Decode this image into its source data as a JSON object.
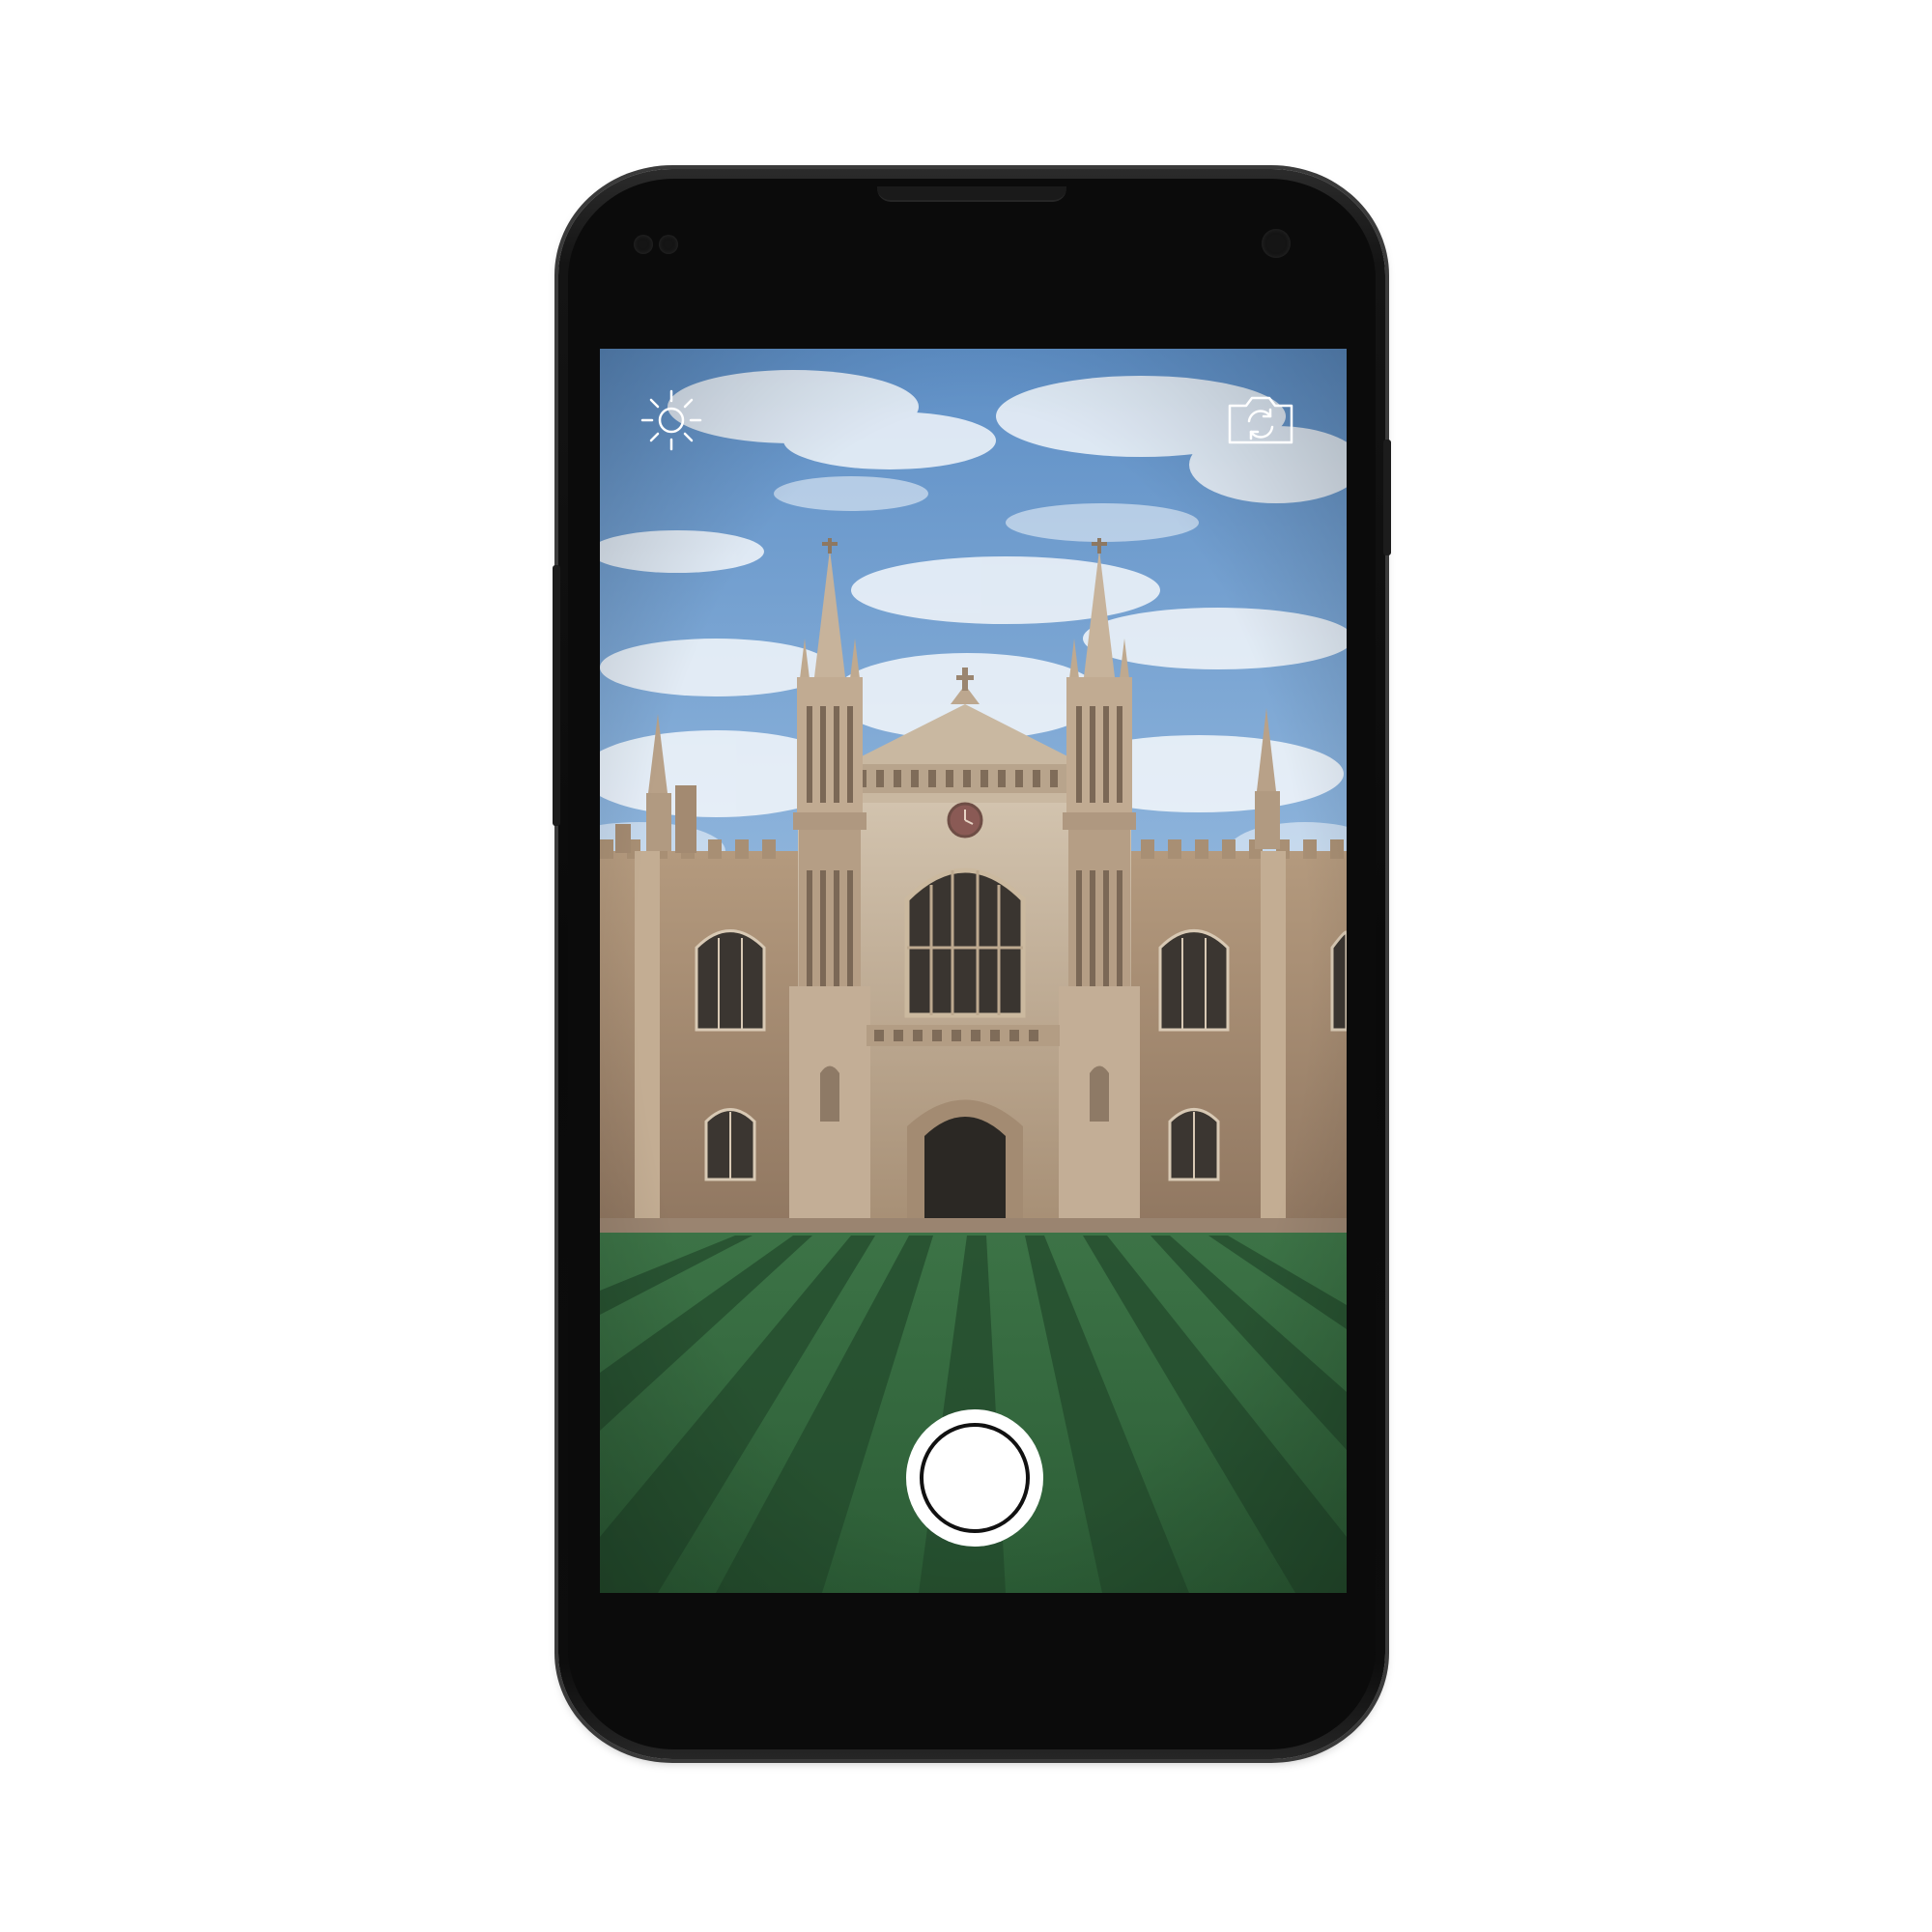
{
  "app": {
    "screen": "camera-viewfinder"
  },
  "controls": {
    "brightness_icon": "sun-icon",
    "switch_camera_icon": "camera-switch-icon",
    "shutter": "shutter-button"
  },
  "colors": {
    "phone_body": "#0b0b0b",
    "icon_stroke": "#ffffff",
    "shutter_fill": "#ffffff",
    "shutter_ring": "#111111",
    "sky": "#6b9bd0",
    "lawn_light": "#3f7a49",
    "lawn_dark": "#244f2f",
    "stone": "#b9a38a"
  }
}
